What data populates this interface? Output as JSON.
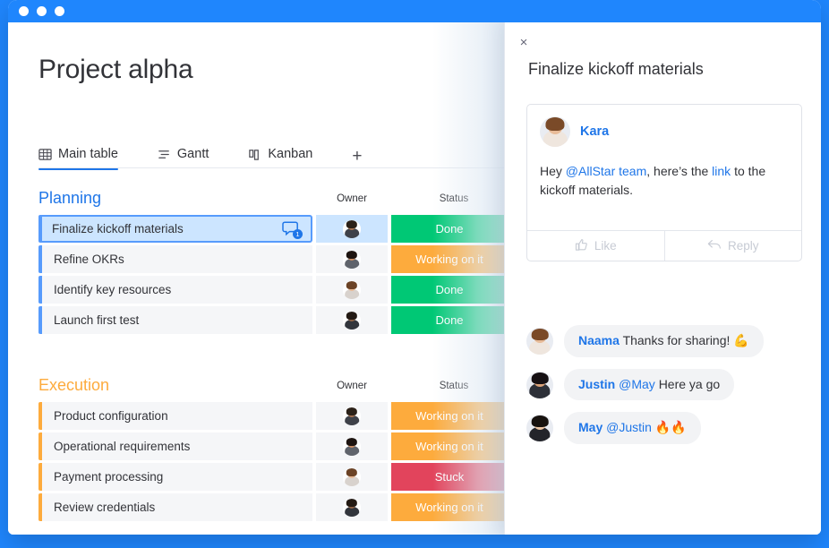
{
  "window": {
    "dots": [
      "close",
      "minimize",
      "maximize"
    ]
  },
  "board": {
    "title": "Project alpha",
    "tabs": [
      {
        "label": "Main table",
        "icon": "table-icon",
        "active": true
      },
      {
        "label": "Gantt",
        "icon": "gantt-icon",
        "active": false
      },
      {
        "label": "Kanban",
        "icon": "kanban-icon",
        "active": false
      }
    ],
    "add_tab_label": "+",
    "columns": {
      "owner": "Owner",
      "status": "Status"
    },
    "groups": [
      {
        "name": "Planning",
        "color": "#1f76e8",
        "bar_color": "#579bfc",
        "rows": [
          {
            "name": "Finalize kickoff materials",
            "status": "Done",
            "status_color": "#00c875",
            "selected": true,
            "comment_count": "1",
            "avatar": "p1"
          },
          {
            "name": "Refine OKRs",
            "status": "Working on it",
            "status_color": "#fdab3d",
            "selected": false,
            "avatar": "p2"
          },
          {
            "name": "Identify key resources",
            "status": "Done",
            "status_color": "#00c875",
            "selected": false,
            "avatar": "p3"
          },
          {
            "name": "Launch first test",
            "status": "Done",
            "status_color": "#00c875",
            "selected": false,
            "avatar": "p4"
          }
        ]
      },
      {
        "name": "Execution",
        "color": "#fdab3d",
        "bar_color": "#fdab3d",
        "rows": [
          {
            "name": "Product configuration",
            "status": "Working on it",
            "status_color": "#fdab3d",
            "selected": false,
            "avatar": "p1"
          },
          {
            "name": "Operational requirements",
            "status": "Working on it",
            "status_color": "#fdab3d",
            "selected": false,
            "avatar": "p2"
          },
          {
            "name": "Payment processing",
            "status": "Stuck",
            "status_color": "#e2445c",
            "selected": false,
            "avatar": "p3"
          },
          {
            "name": "Review credentials",
            "status": "Working on it",
            "status_color": "#fdab3d",
            "selected": false,
            "avatar": "p4"
          }
        ]
      }
    ]
  },
  "panel": {
    "close_label": "×",
    "title": "Finalize kickoff materials",
    "comment": {
      "author": "Kara",
      "text_part1": "Hey ",
      "mention": "@AllStar team",
      "text_part2": ", here’s the ",
      "link": "link",
      "text_part3": " to the kickoff materials.",
      "like_label": "Like",
      "reply_label": "Reply"
    },
    "replies": [
      {
        "name": "Naama",
        "mention": "",
        "text": "Thanks for sharing!",
        "emoji": "💪",
        "avatar": "p5"
      },
      {
        "name": "Justin",
        "mention": "@May",
        "text": "Here ya go",
        "emoji": "",
        "avatar": "p6"
      },
      {
        "name": "May",
        "mention": "@Justin",
        "text": "",
        "emoji": "🔥🔥",
        "avatar": "p7"
      }
    ]
  },
  "colors": {
    "brand_blue": "#1f86fd",
    "link_blue": "#1f76e8",
    "green": "#00c875",
    "orange": "#fdab3d",
    "red": "#e2445c"
  }
}
